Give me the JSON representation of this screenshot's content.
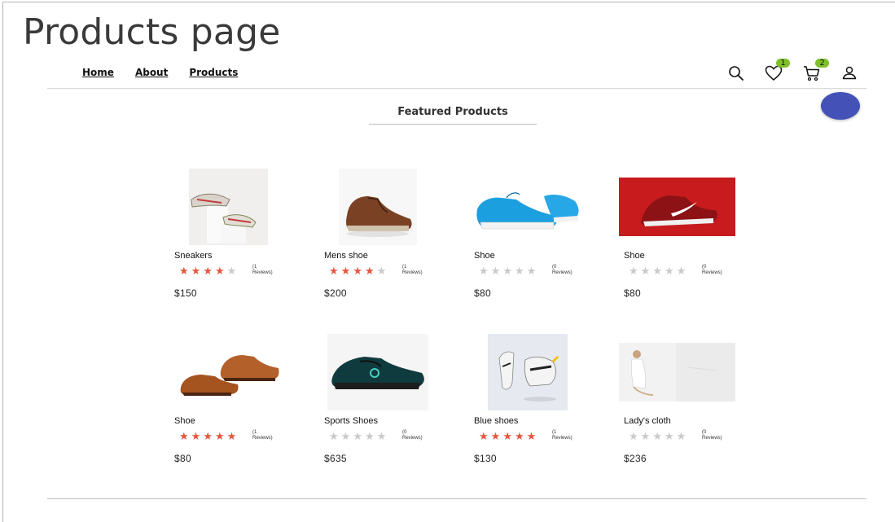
{
  "page": {
    "heading": "Products page"
  },
  "nav": {
    "items": [
      {
        "label": "Home"
      },
      {
        "label": "About"
      },
      {
        "label": "Products"
      }
    ]
  },
  "header": {
    "wishlist_count": "1",
    "cart_count": "2"
  },
  "featured": {
    "title": "Featured Products"
  },
  "colors": {
    "accent_fab": "#4452b8",
    "badge": "#7fbf2c",
    "star_on": "#e8553e",
    "star_off": "#c9c9c9"
  },
  "products": [
    {
      "name": "Sneakers",
      "rating": 4,
      "reviews_count": "(1",
      "reviews_word": "Reviews)",
      "price": "$150"
    },
    {
      "name": "Mens shoe",
      "rating": 4,
      "reviews_count": "(1",
      "reviews_word": "Reviews)",
      "price": "$200"
    },
    {
      "name": "Shoe",
      "rating": 0,
      "reviews_count": "(0",
      "reviews_word": "Reviews)",
      "price": "$80"
    },
    {
      "name": "Shoe",
      "rating": 0,
      "reviews_count": "(0",
      "reviews_word": "Reviews)",
      "price": "$80"
    },
    {
      "name": "Shoe",
      "rating": 5,
      "reviews_count": "(1",
      "reviews_word": "Reviews)",
      "price": "$80"
    },
    {
      "name": "Sports Shoes",
      "rating": 0,
      "reviews_count": "(0",
      "reviews_word": "Reviews)",
      "price": "$635"
    },
    {
      "name": "Blue shoes",
      "rating": 5,
      "reviews_count": "(1",
      "reviews_word": "Reviews)",
      "price": "$130"
    },
    {
      "name": "Lady's cloth",
      "rating": 0,
      "reviews_count": "(0",
      "reviews_word": "Reviews)",
      "price": "$236"
    }
  ]
}
